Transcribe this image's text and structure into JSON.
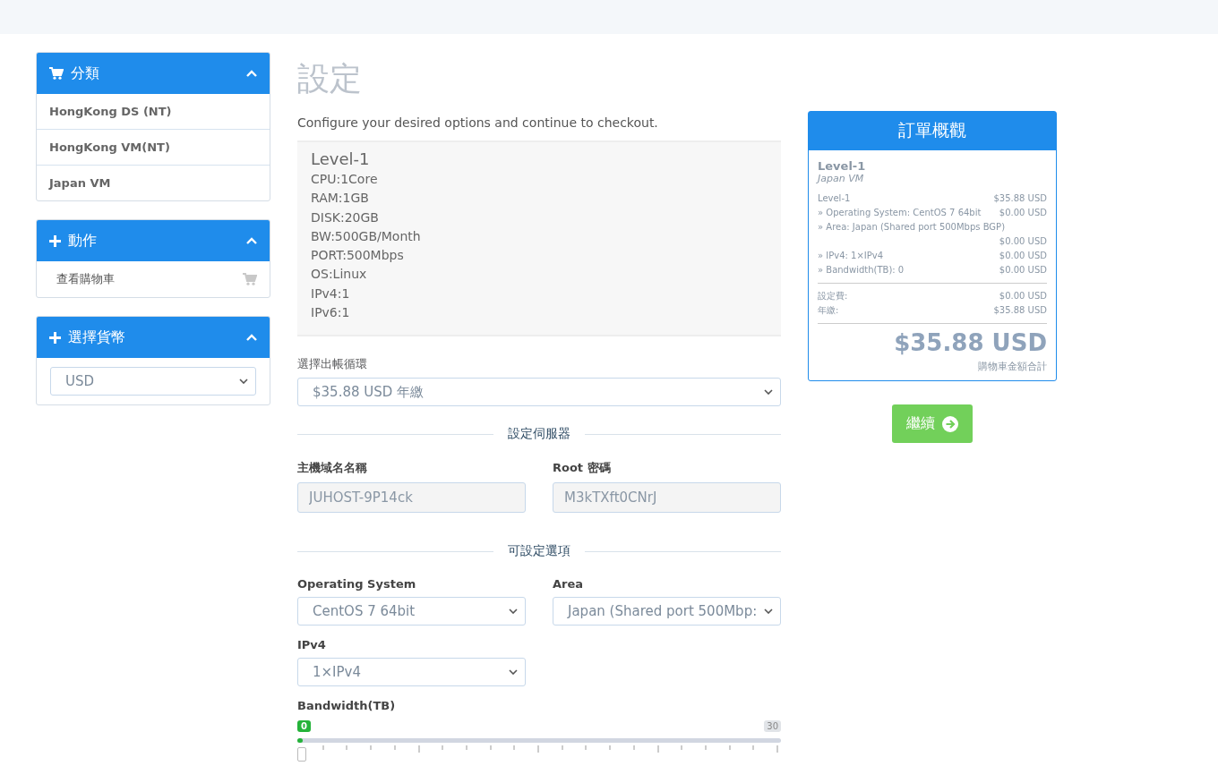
{
  "sidebar": [
    {
      "kind": "list",
      "title": "分類",
      "expanded": true,
      "items": [
        "HongKong DS (NT)",
        "HongKong VM(NT)",
        "Japan VM"
      ]
    },
    {
      "kind": "actions",
      "title": "動作",
      "expanded": true,
      "items": [
        "查看購物車"
      ]
    },
    {
      "kind": "select",
      "title": "選擇貨幣",
      "expanded": true,
      "value": "USD"
    }
  ],
  "main": {
    "title": "設定",
    "subtitle": "Configure your desired options and continue to checkout.",
    "product": {
      "name": "Level-1",
      "specs": [
        "CPU:1Core",
        "RAM:1GB",
        "DISK:20GB",
        "BW:500GB/Month",
        "PORT:500Mbps",
        "OS:Linux",
        "IPv4:1",
        "IPv6:1"
      ]
    },
    "billing": {
      "label": "選擇出帳循環",
      "value": "$35.88 USD 年繳"
    },
    "server_heading": "設定伺服器",
    "server_fields": [
      {
        "label": "主機域名名稱",
        "value": "JUHOST-9P14ck"
      },
      {
        "label": "Root 密碼",
        "value": "M3kTXft0CNrJ"
      }
    ],
    "options_heading": "可設定選項",
    "options": [
      {
        "kind": "select",
        "label": "Operating System",
        "value": "CentOS 7 64bit"
      },
      {
        "kind": "select",
        "label": "Area",
        "value": "Japan (Shared port 500Mbp:"
      },
      {
        "kind": "select",
        "label": "IPv4",
        "value": "1×IPv4"
      },
      {
        "kind": "slider",
        "label": "Bandwidth(TB)",
        "value": "0",
        "max": "30",
        "level": 0
      }
    ]
  },
  "summary": {
    "title": "訂單概觀",
    "product": "Level-1",
    "group": "Japan VM",
    "lines": [
      {
        "label": "Level-1",
        "price": "$35.88 USD"
      },
      {
        "label": "» Operating System: CentOS 7 64bit",
        "price": "$0.00 USD"
      },
      {
        "label": "» Area: Japan (Shared port 500Mbps BGP)",
        "price": "$0.00 USD"
      },
      {
        "label": "» IPv4: 1×IPv4",
        "price": "$0.00 USD"
      },
      {
        "label": "» Bandwidth(TB): 0",
        "price": "$0.00 USD"
      }
    ],
    "fees": [
      {
        "label": "設定費:",
        "price": "$0.00 USD"
      },
      {
        "label": "年繳:",
        "price": "$35.88 USD"
      }
    ],
    "total": "$35.88 USD",
    "total_label": "購物車金額合計",
    "continue": "繼續"
  }
}
